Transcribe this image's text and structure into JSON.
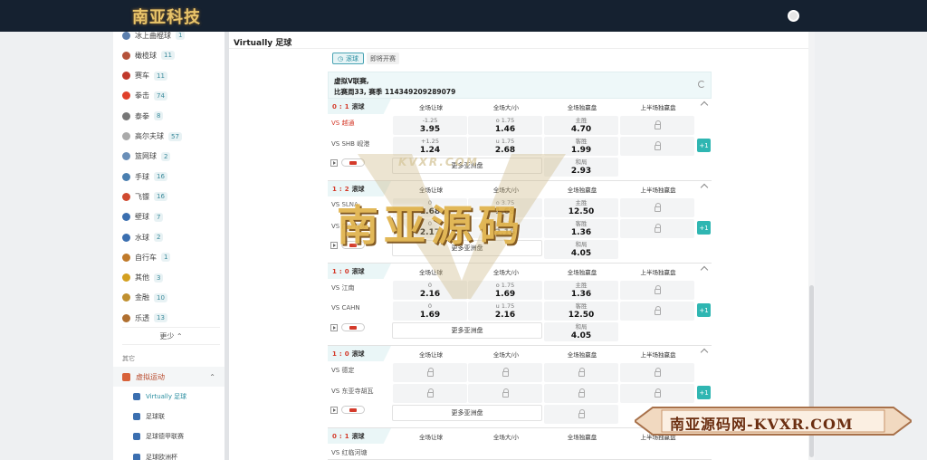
{
  "header": {
    "logo_text": "南亚科技"
  },
  "sidebar": {
    "items": [
      {
        "label": "冰上曲棍球",
        "count": "1",
        "color": "#5b7fae"
      },
      {
        "label": "橄榄球",
        "count": "11",
        "color": "#b5523a"
      },
      {
        "label": "赛车",
        "count": "11",
        "color": "#c0392b"
      },
      {
        "label": "拳击",
        "count": "74",
        "color": "#e0402a"
      },
      {
        "label": "泰拳",
        "count": "8",
        "color": "#777777"
      },
      {
        "label": "高尔夫球",
        "count": "57",
        "color": "#aaaaaa"
      },
      {
        "label": "篮网球",
        "count": "2",
        "color": "#6a8fb8"
      },
      {
        "label": "手球",
        "count": "16",
        "color": "#4a7fb0"
      },
      {
        "label": "飞镖",
        "count": "16",
        "color": "#d04a30"
      },
      {
        "label": "壁球",
        "count": "7",
        "color": "#3b6fb0"
      },
      {
        "label": "水球",
        "count": "2",
        "color": "#3b6fb0"
      },
      {
        "label": "自行车",
        "count": "1",
        "color": "#c07a2a"
      },
      {
        "label": "其他",
        "count": "3",
        "color": "#d4a020"
      },
      {
        "label": "金融",
        "count": "10",
        "color": "#c09030"
      },
      {
        "label": "乐透",
        "count": "13",
        "color": "#b07030"
      }
    ],
    "less_label": "更少",
    "section_label": "其它",
    "virtual_label": "虚拟运动",
    "sub_items": [
      "Virtually 足球",
      "足球联",
      "足球德甲联赛",
      "足球欧洲杯"
    ]
  },
  "main": {
    "title": "Virtually 足球",
    "tab_live": "滚球",
    "tab_upcoming": "即将开赛",
    "league_name": "虚拟V联赛,",
    "league_round": "比赛周33, 赛季 114349209289079",
    "col_headers": [
      "全场让球",
      "全场大/小",
      "全场独赢盘",
      "上半场独赢盘"
    ],
    "more_label": "更多亚洲盘",
    "plus_label": "+1",
    "live_label": "滚球",
    "matches": [
      {
        "score_a": "0",
        "score_b": "1",
        "home": "VS 越通",
        "away": "VS SHB 岘港",
        "hcap": [
          {
            "t": "-1.25",
            "v": "3.95"
          },
          {
            "t": "+1.25",
            "v": "1.24"
          }
        ],
        "ou": [
          {
            "t": "o 1.75",
            "v": "1.46"
          },
          {
            "t": "u 1.75",
            "v": "2.68"
          }
        ],
        "x12": [
          {
            "t": "主胜",
            "v": "4.70"
          },
          {
            "t": "客胜",
            "v": "1.99"
          },
          {
            "t": "和局",
            "v": "2.93"
          }
        ]
      },
      {
        "score_a": "1",
        "score_b": "2",
        "home": "VS SLNA",
        "away": "VS 广宁煤炭",
        "hcap": [
          {
            "t": "0",
            "v": "1.68"
          },
          {
            "t": "0",
            "v": "2.17"
          }
        ],
        "ou": [
          {
            "t": "o 3.75",
            "v": "1.69"
          },
          {
            "t": "u 3.75",
            "v": "2.16"
          }
        ],
        "x12": [
          {
            "t": "主胜",
            "v": "12.50"
          },
          {
            "t": "客胜",
            "v": "1.36"
          },
          {
            "t": "和局",
            "v": "4.05"
          }
        ]
      },
      {
        "score_a": "1",
        "score_b": "0",
        "home": "VS 江南",
        "away": "VS CAHN",
        "hcap": [
          {
            "t": "0",
            "v": "2.16"
          },
          {
            "t": "0",
            "v": "1.69"
          }
        ],
        "ou": [
          {
            "t": "o 1.75",
            "v": "1.69"
          },
          {
            "t": "u 1.75",
            "v": "2.16"
          }
        ],
        "x12": [
          {
            "t": "主胜",
            "v": "1.36"
          },
          {
            "t": "客胜",
            "v": "12.50"
          },
          {
            "t": "和局",
            "v": "4.05"
          }
        ]
      },
      {
        "score_a": "1",
        "score_b": "0",
        "home": "VS 德定",
        "away": "VS 东亚寺胡瓦"
      },
      {
        "score_a": "0",
        "score_b": "1",
        "home": "VS 红临河塘"
      }
    ]
  },
  "watermark": {
    "big": "南亚源码",
    "small": "KVXR.COM",
    "banner": "南亚源码网-KVXR.COM"
  }
}
